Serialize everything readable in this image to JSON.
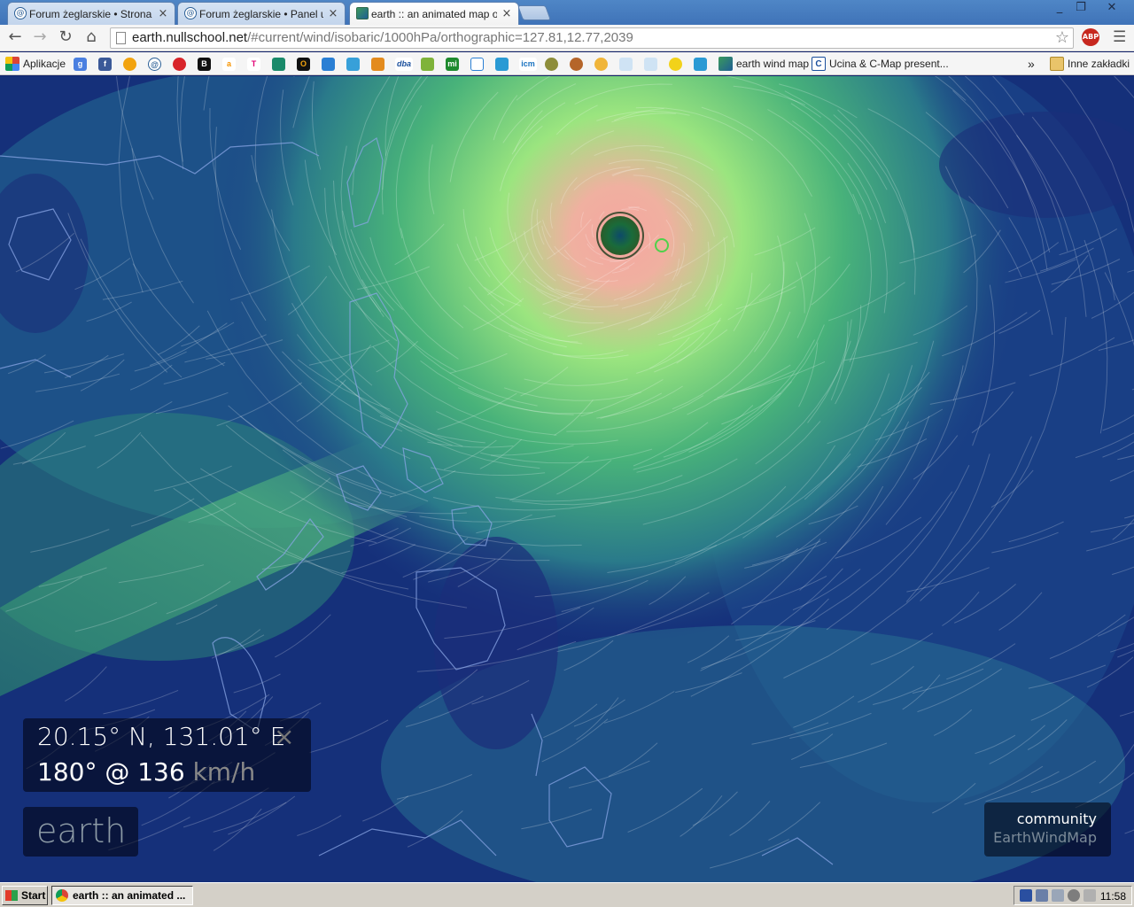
{
  "browser": {
    "tabs": [
      {
        "title": "Forum żeglarskie • Strona gł",
        "active": false
      },
      {
        "title": "Forum żeglarskie • Panel uży",
        "active": false
      },
      {
        "title": "earth :: an animated map of g",
        "active": true
      }
    ],
    "window_controls": {
      "minimize": "_",
      "restore": "❐",
      "close": "✕"
    },
    "url_host": "earth.nullschool.net",
    "url_rest": "/#current/wind/isobaric/1000hPa/orthographic=127.81,12.77,2039",
    "abp_label": "ABP",
    "overflow": "»"
  },
  "bookmarks": {
    "apps_label": "Aplikacje",
    "earth_label": "earth wind map",
    "ucina_label": "Ucina & C-Map present...",
    "folder_label": "Inne zakładki",
    "icon_letters": [
      "B",
      "a",
      "T",
      "O",
      "dba",
      "mi",
      "icm"
    ]
  },
  "map": {
    "location": "20.15° N, 131.01° E",
    "close_symbol": "×",
    "wind": "180° @ 136",
    "wind_units": "km/h",
    "logo": "earth",
    "community_label": "community",
    "community_link": "EarthWindMap",
    "colors": {
      "ocean_calm": "#13296e",
      "wind_mid": "#2e8a8a",
      "wind_strong": "#8ee07a",
      "storm_core": "#f4a6a0"
    }
  },
  "taskbar": {
    "start_label": "Start",
    "task_title": "earth :: an animated ...",
    "clock": "11:58"
  }
}
